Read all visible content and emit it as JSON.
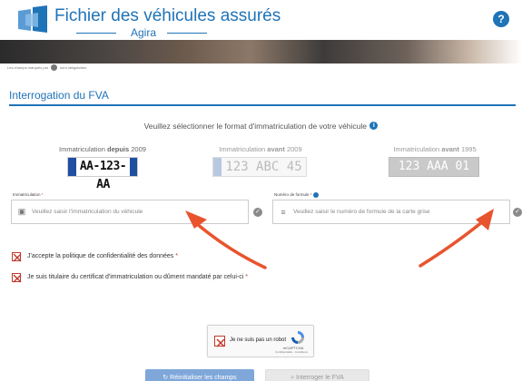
{
  "header": {
    "title": "Fichier des véhicules assurés",
    "subtitle": "Agira",
    "help_label": "?"
  },
  "required_note": {
    "text": "Les champs marqués par",
    "suffix": "sont obligatoires"
  },
  "section": {
    "title": "Interrogation du FVA"
  },
  "format": {
    "prompt": "Veuillez sélectionner le format d'immatriculation de votre véhicule",
    "info_icon": "i",
    "options": [
      {
        "prefix": "Immatriculation ",
        "emph": "depuis",
        "year": " 2009",
        "plate": "AA-123-AA",
        "selected": true
      },
      {
        "prefix": "Immatriculation ",
        "emph": "avant",
        "year": " 2009",
        "plate": "123 ABC 45",
        "selected": false
      },
      {
        "prefix": "Immatriculation ",
        "emph": "avant",
        "year": " 1995",
        "plate": "123 AAA 01",
        "selected": false
      }
    ]
  },
  "fields": {
    "immat": {
      "label": "Immatriculation",
      "required_mark": "*",
      "placeholder": "Veuillez saisir l'immatriculation du véhicule",
      "icon": "car-icon"
    },
    "formule": {
      "label": "Numéro de formule",
      "required_mark": "*",
      "placeholder": "Veuillez saisir le numéro de formule de la carte grise",
      "icon": "lines-icon"
    }
  },
  "consents": [
    {
      "text": "J'accepte la politique de confidentialité des données",
      "required_mark": " *"
    },
    {
      "text": "Je suis titulaire du certificat d'immatriculation ou dûment mandaté par celui-ci",
      "required_mark": " *"
    }
  ],
  "recaptcha": {
    "label": "Je ne suis pas un robot",
    "brand": "reCAPTCHA",
    "links": "Confidentialité - Conditions"
  },
  "buttons": {
    "reset": "↻  Réinitialiser les champs",
    "query": "⌕  Interroger le FVA"
  },
  "colors": {
    "brand": "#1f73b7",
    "arrow": "#e8542e",
    "checkbox": "#c0392b"
  }
}
